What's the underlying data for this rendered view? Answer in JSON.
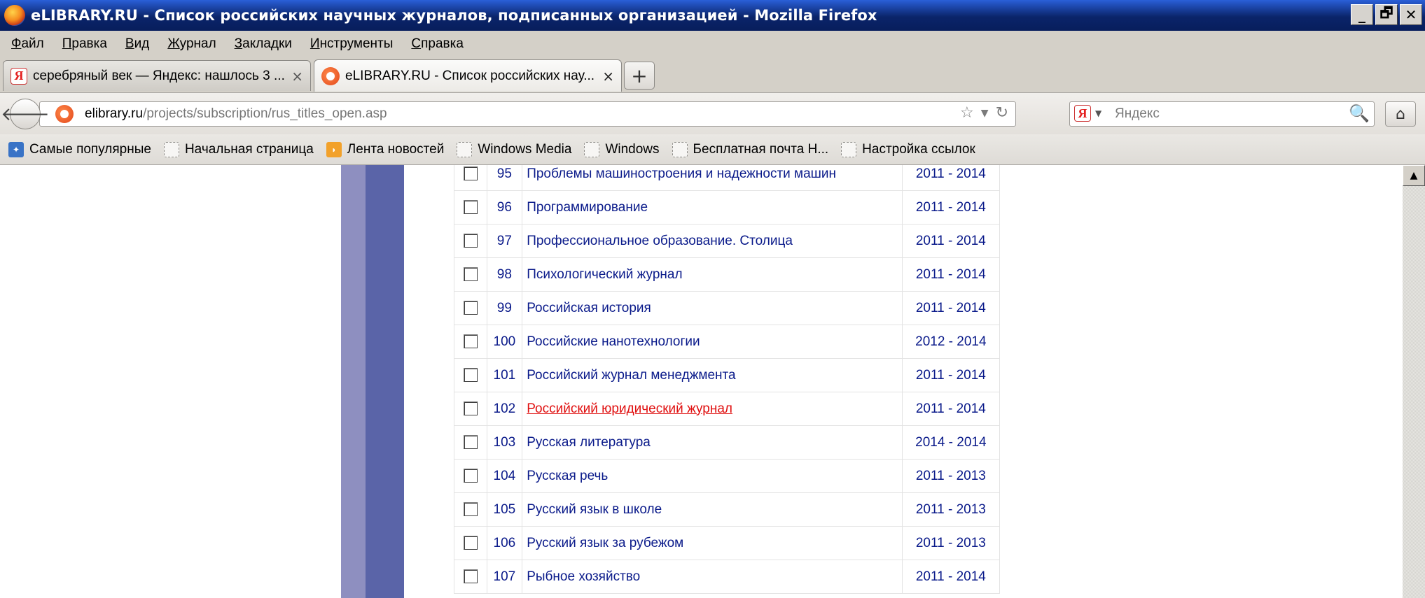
{
  "window": {
    "title": "eLIBRARY.RU - Список российских научных журналов, подписанных организацией - Mozilla Firefox",
    "controls": [
      "_",
      "🗗",
      "✕"
    ]
  },
  "menu": [
    "Файл",
    "Правка",
    "Вид",
    "Журнал",
    "Закладки",
    "Инструменты",
    "Справка"
  ],
  "tabs": [
    {
      "label": "серебряный век — Яндекс: нашлось 3 ...",
      "close": "×"
    },
    {
      "label": "eLIBRARY.RU - Список российских нау...",
      "close": "×"
    }
  ],
  "new_tab_symbol": "+",
  "address": {
    "domain": "elibrary.ru",
    "path": "/projects/subscription/rus_titles_open.asp"
  },
  "search": {
    "placeholder": "Яндекс"
  },
  "bookmarks": [
    {
      "label": "Самые популярные",
      "icon": "popular"
    },
    {
      "label": "Начальная страница",
      "icon": "page"
    },
    {
      "label": "Лента новостей",
      "icon": "rss"
    },
    {
      "label": "Windows Media",
      "icon": "page"
    },
    {
      "label": "Windows",
      "icon": "page"
    },
    {
      "label": "Бесплатная почта H...",
      "icon": "page"
    },
    {
      "label": "Настройка ссылок",
      "icon": "page"
    }
  ],
  "journals": [
    {
      "num": "95",
      "title": "Проблемы машиностроения и надежности машин",
      "years": "2011 - 2014",
      "highlight": false
    },
    {
      "num": "96",
      "title": "Программирование",
      "years": "2011 - 2014",
      "highlight": false
    },
    {
      "num": "97",
      "title": "Профессиональное образование. Столица",
      "years": "2011 - 2014",
      "highlight": false
    },
    {
      "num": "98",
      "title": "Психологический журнал",
      "years": "2011 - 2014",
      "highlight": false
    },
    {
      "num": "99",
      "title": "Российская история",
      "years": "2011 - 2014",
      "highlight": false
    },
    {
      "num": "100",
      "title": "Российские нанотехнологии",
      "years": "2012 - 2014",
      "highlight": false
    },
    {
      "num": "101",
      "title": "Российский журнал менеджмента",
      "years": "2011 - 2014",
      "highlight": false
    },
    {
      "num": "102",
      "title": "Российский юридический журнал",
      "years": "2011 - 2014",
      "highlight": true
    },
    {
      "num": "103",
      "title": "Русская литература",
      "years": "2014 - 2014",
      "highlight": false
    },
    {
      "num": "104",
      "title": "Русская речь",
      "years": "2011 - 2013",
      "highlight": false
    },
    {
      "num": "105",
      "title": "Русский язык в школе",
      "years": "2011 - 2013",
      "highlight": false
    },
    {
      "num": "106",
      "title": "Русский язык за рубежом",
      "years": "2011 - 2013",
      "highlight": false
    },
    {
      "num": "107",
      "title": "Рыбное хозяйство",
      "years": "2011 - 2014",
      "highlight": false
    }
  ]
}
